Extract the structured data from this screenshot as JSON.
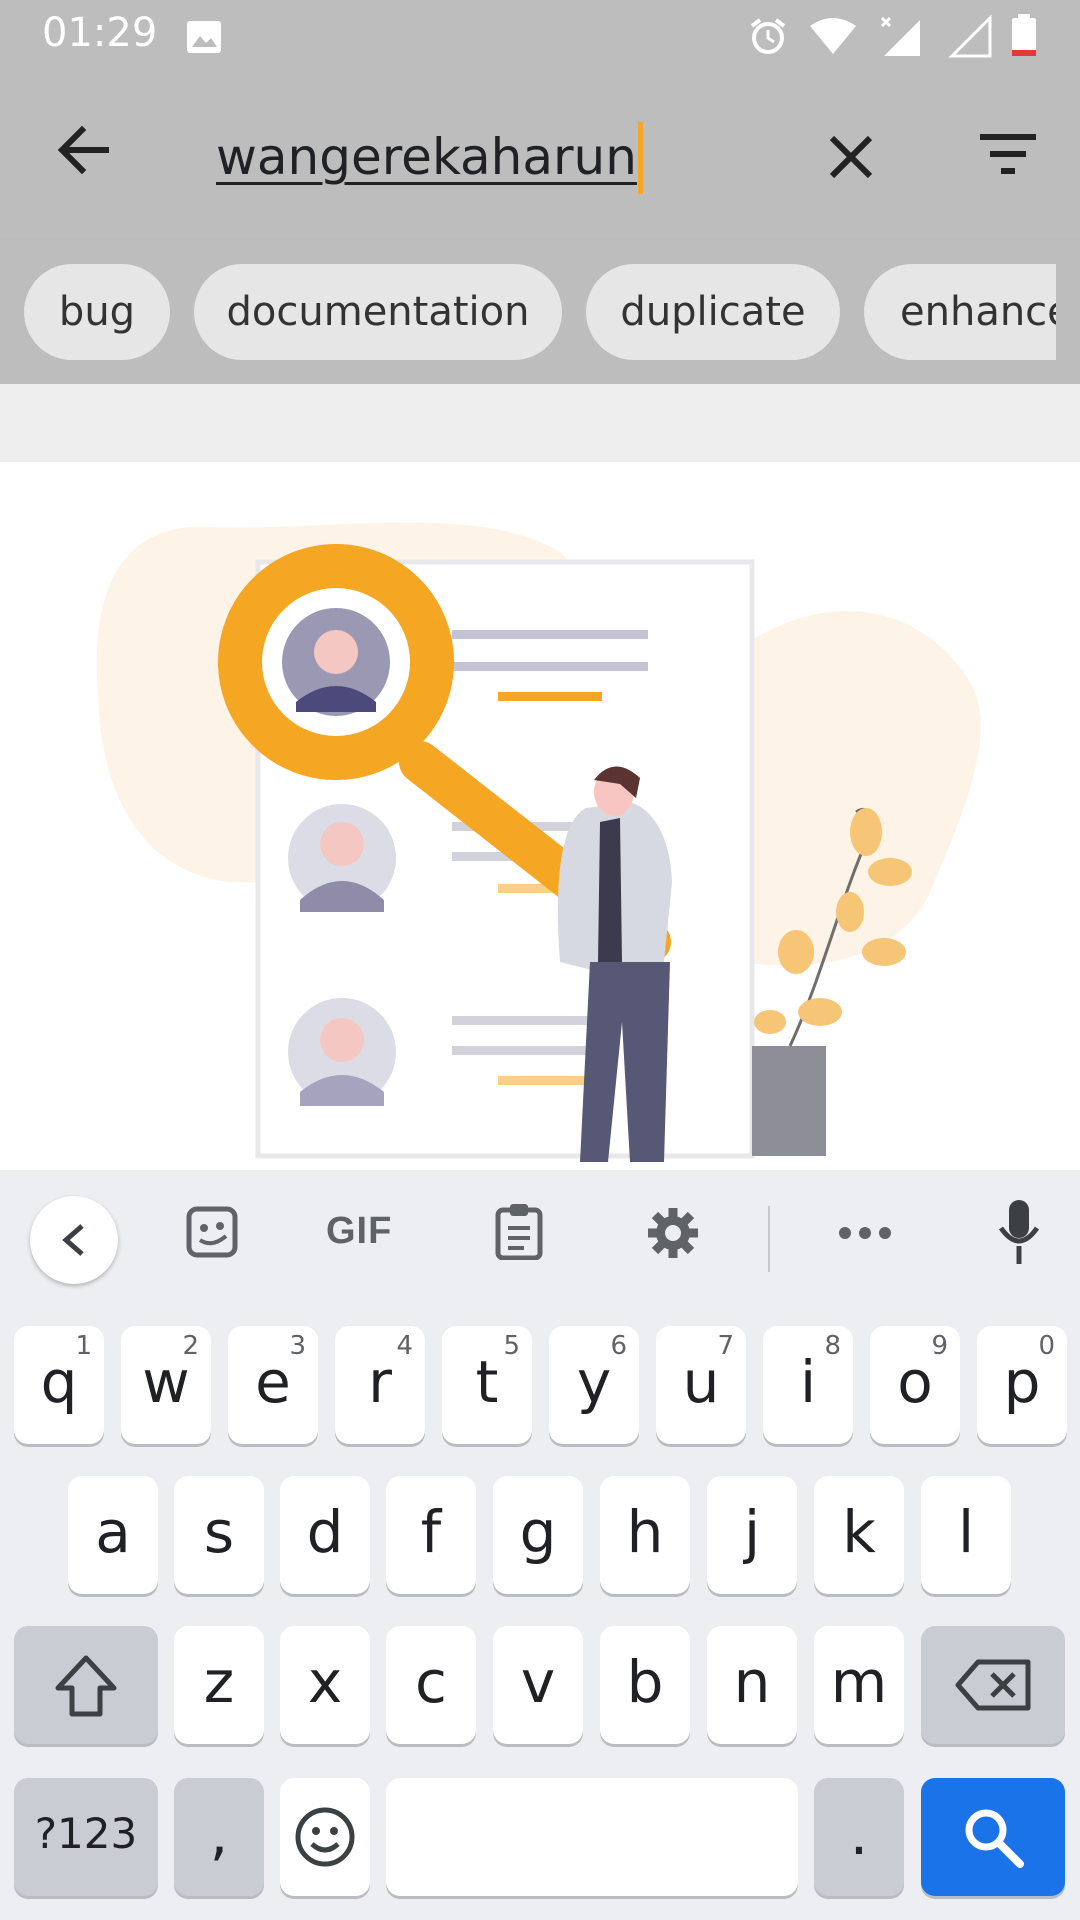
{
  "status_bar": {
    "time": "01:29"
  },
  "search": {
    "query": "wangerekaharun"
  },
  "chips": [
    "bug",
    "documentation",
    "duplicate",
    "enhance"
  ],
  "keyboard": {
    "toolbar": {
      "gif_label": "GIF"
    },
    "row1": [
      {
        "k": "q",
        "h": "1"
      },
      {
        "k": "w",
        "h": "2"
      },
      {
        "k": "e",
        "h": "3"
      },
      {
        "k": "r",
        "h": "4"
      },
      {
        "k": "t",
        "h": "5"
      },
      {
        "k": "y",
        "h": "6"
      },
      {
        "k": "u",
        "h": "7"
      },
      {
        "k": "i",
        "h": "8"
      },
      {
        "k": "o",
        "h": "9"
      },
      {
        "k": "p",
        "h": "0"
      }
    ],
    "row2": [
      "a",
      "s",
      "d",
      "f",
      "g",
      "h",
      "j",
      "k",
      "l"
    ],
    "row3": [
      "z",
      "x",
      "c",
      "v",
      "b",
      "n",
      "m"
    ],
    "symbols_label": "?123",
    "comma": ",",
    "period": "."
  },
  "colors": {
    "accent": "#f5a623",
    "keyboard_action": "#1a73e8",
    "appbar": "#bdbdbd"
  }
}
